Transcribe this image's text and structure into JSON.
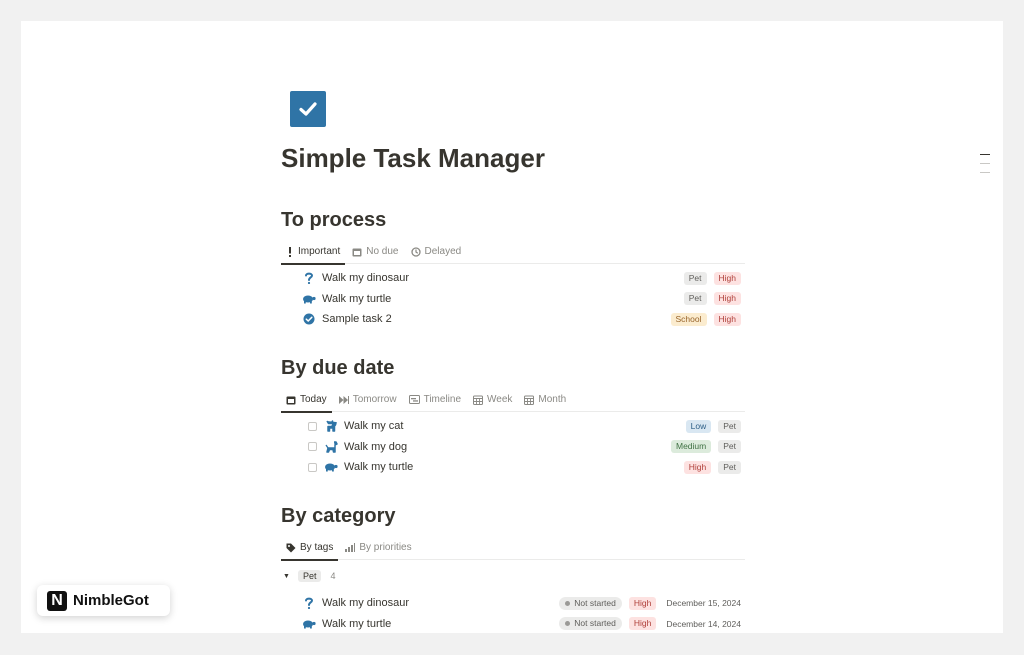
{
  "page": {
    "title": "Simple Task Manager",
    "icon": "checkbox-icon"
  },
  "sections": {
    "to_process": {
      "title": "To process",
      "tabs": [
        {
          "label": "Important",
          "icon": "exclamation-icon"
        },
        {
          "label": "No due",
          "icon": "calendar-icon"
        },
        {
          "label": "Delayed",
          "icon": "history-icon"
        }
      ],
      "rows": [
        {
          "icon": "question-icon",
          "title": "Walk my dinosaur",
          "tags": [
            "Pet",
            "High"
          ]
        },
        {
          "icon": "turtle-icon",
          "title": "Walk my turtle",
          "tags": [
            "Pet",
            "High"
          ]
        },
        {
          "icon": "check-circle-icon",
          "title": "Sample task 2",
          "tags": [
            "School",
            "High"
          ]
        }
      ]
    },
    "by_due_date": {
      "title": "By due date",
      "tabs": [
        {
          "label": "Today",
          "icon": "calendar-icon"
        },
        {
          "label": "Tomorrow",
          "icon": "fast-forward-icon"
        },
        {
          "label": "Timeline",
          "icon": "timeline-icon"
        },
        {
          "label": "Week",
          "icon": "calendar-grid-icon"
        },
        {
          "label": "Month",
          "icon": "calendar-grid-icon"
        }
      ],
      "rows": [
        {
          "icon": "cat-icon",
          "title": "Walk my cat",
          "tags": [
            "Low",
            "Pet"
          ]
        },
        {
          "icon": "dog-icon",
          "title": "Walk my dog",
          "tags": [
            "Medium",
            "Pet"
          ]
        },
        {
          "icon": "turtle-icon",
          "title": "Walk my turtle",
          "tags": [
            "High",
            "Pet"
          ]
        }
      ]
    },
    "by_category": {
      "title": "By category",
      "tabs": [
        {
          "label": "By tags",
          "icon": "tag-icon"
        },
        {
          "label": "By priorities",
          "icon": "bar-chart-icon"
        }
      ],
      "group": {
        "label": "Pet",
        "count": "4"
      },
      "rows": [
        {
          "icon": "question-icon",
          "title": "Walk my dinosaur",
          "status": "Not started",
          "priority": "High",
          "date": "December 15, 2024"
        },
        {
          "icon": "turtle-icon",
          "title": "Walk my turtle",
          "status": "Not started",
          "priority": "High",
          "date": "December 14, 2024"
        }
      ]
    }
  },
  "badge": {
    "logo_letter": "N",
    "text": "NimbleGot"
  },
  "colors": {
    "accent": "#2f74a6",
    "tag_gray": "#ebebea",
    "tag_red": "#fde2e1",
    "tag_orange": "#fbeccf",
    "tag_blue": "#d9e7f2",
    "tag_green": "#dcebdc"
  }
}
